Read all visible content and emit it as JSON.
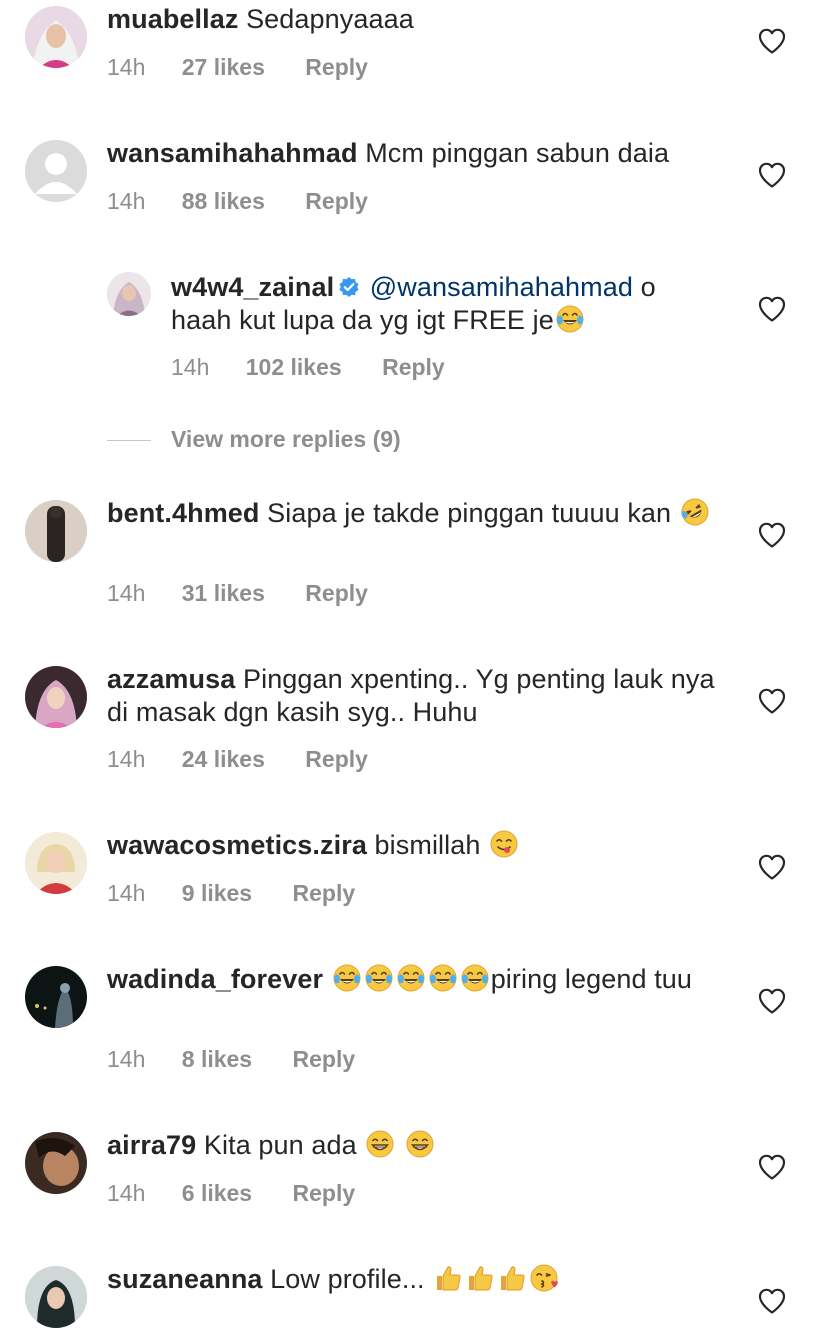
{
  "labels": {
    "reply": "Reply",
    "view_more_replies": "View more replies (9)"
  },
  "colors": {
    "text": "#262626",
    "meta": "#8e8e8e",
    "mention": "#003569",
    "verified": "#3897f0",
    "background": "#ffffff"
  },
  "icons": {
    "like": "heart-outline-icon",
    "verified": "verified-badge-icon",
    "emoji_tears_of_joy": "face-with-tears-of-joy",
    "emoji_rofl": "rolling-on-the-floor-laughing",
    "emoji_yum": "face-savoring-food",
    "emoji_grin": "grinning-face-with-smiling-eyes",
    "emoji_thumbs_up": "thumbs-up",
    "emoji_kiss": "face-blowing-a-kiss"
  },
  "comments": [
    {
      "username": "muabellaz",
      "text": "Sedapnyaaaa",
      "time": "14h",
      "likes": "27 likes"
    },
    {
      "username": "wansamihahahmad",
      "text": "Mcm pinggan sabun daia",
      "time": "14h",
      "likes": "88 likes"
    },
    {
      "username": "w4w4_zainal",
      "mention": "@wansamihahahmad",
      "text": "o haah kut lupa da yg igt FREE je",
      "time": "14h",
      "likes": "102 likes",
      "verified": true
    },
    {
      "username": "bent.4hmed",
      "text": "Siapa je takde pinggan tuuuu kan",
      "time": "14h",
      "likes": "31 likes"
    },
    {
      "username": "azzamusa",
      "text": "Pinggan xpenting.. Yg penting lauk nya di masak dgn kasih syg.. Huhu",
      "time": "14h",
      "likes": "24 likes"
    },
    {
      "username": "wawacosmetics.zira",
      "text": "bismillah",
      "time": "14h",
      "likes": "9 likes"
    },
    {
      "username": "wadinda_forever",
      "text": "piring legend tuu",
      "time": "14h",
      "likes": "8 likes"
    },
    {
      "username": "airra79",
      "text": "Kita pun ada",
      "time": "14h",
      "likes": "6 likes"
    },
    {
      "username": "suzaneanna",
      "text": "Low profile...",
      "time": "",
      "likes": ""
    }
  ]
}
